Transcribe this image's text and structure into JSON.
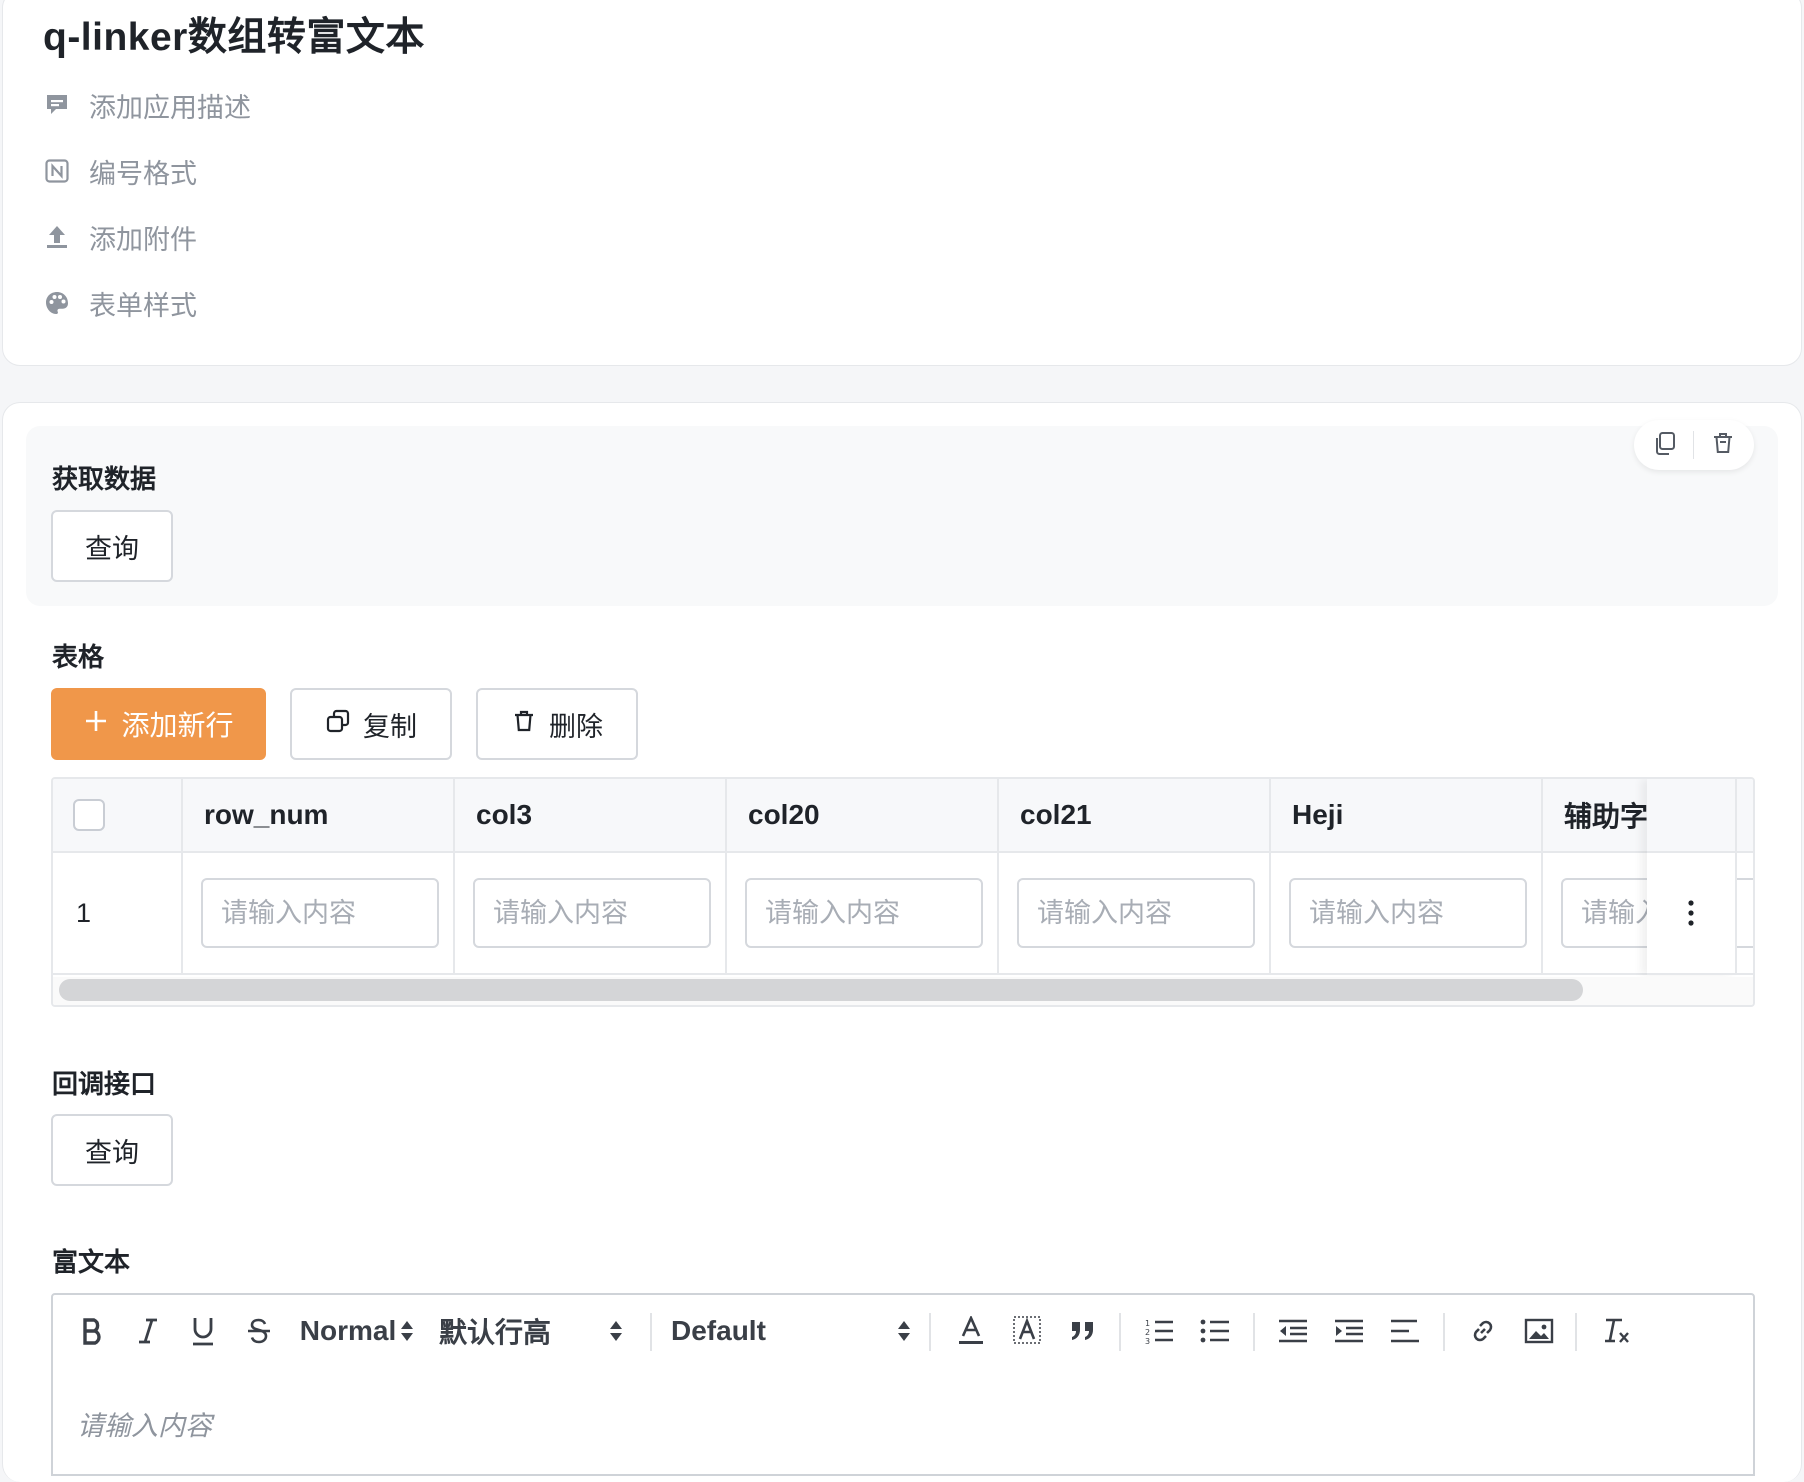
{
  "app": {
    "title": "q-linker数组转富文本",
    "meta": [
      {
        "label": "添加应用描述",
        "icon": "comment-icon"
      },
      {
        "label": "编号格式",
        "icon": "numbering-icon"
      },
      {
        "label": "添加附件",
        "icon": "upload-icon"
      },
      {
        "label": "表单样式",
        "icon": "palette-icon"
      }
    ]
  },
  "fetch": {
    "label": "获取数据",
    "query_button": "查询"
  },
  "table": {
    "label": "表格",
    "add_row_button": "添加新行",
    "copy_button": "复制",
    "delete_button": "删除",
    "columns": [
      "row_num",
      "col3",
      "col20",
      "col21",
      "Heji",
      "辅助字"
    ],
    "rows": [
      {
        "index": "1",
        "placeholder": "请输入内容"
      }
    ]
  },
  "callback": {
    "label": "回调接口",
    "query_button": "查询"
  },
  "richtext": {
    "label": "富文本",
    "size_select": "Normal",
    "line_height_select": "默认行高",
    "font_select": "Default",
    "placeholder": "请输入内容",
    "buttons": [
      "bold",
      "italic",
      "underline",
      "strike",
      "text-color",
      "background-color",
      "blockquote",
      "ordered-list",
      "bullet-list",
      "outdent",
      "indent",
      "align",
      "link",
      "image",
      "clear-format"
    ]
  },
  "colors": {
    "primary": "#f0974a",
    "border": "#d5d8dd",
    "muted_text": "#8f959e"
  }
}
